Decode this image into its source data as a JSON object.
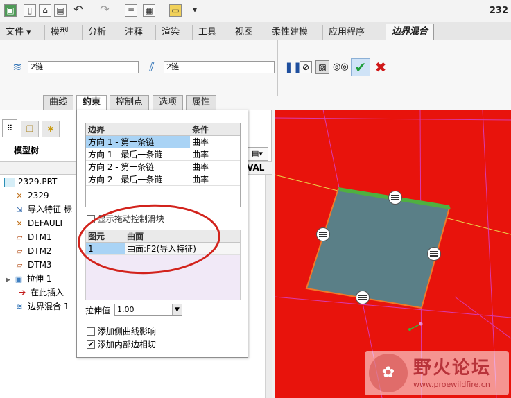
{
  "window": {
    "title_number": "232"
  },
  "ribbon": {
    "tabs": [
      "文件 ▾",
      "模型",
      "分析",
      "注释",
      "渲染",
      "工具",
      "视图",
      "柔性建模",
      "应用程序",
      "边界混合"
    ],
    "active_tab": "边界混合"
  },
  "dashboard": {
    "first_direction_chain": "2链",
    "second_direction_chain": "2链",
    "subtabs": [
      "曲线",
      "约束",
      "控制点",
      "选项",
      "属性"
    ],
    "active_subtab": "约束"
  },
  "model_tree": {
    "header": "模型树",
    "partial_column": "VAL",
    "items": [
      {
        "label": "2329.PRT",
        "icon": "part-icon"
      },
      {
        "label": "2329",
        "icon": "csys-icon"
      },
      {
        "label": "导入特征 标",
        "icon": "import-feature-icon"
      },
      {
        "label": "DEFAULT",
        "icon": "csys-icon"
      },
      {
        "label": "DTM1",
        "icon": "datum-plane-icon"
      },
      {
        "label": "DTM2",
        "icon": "datum-plane-icon"
      },
      {
        "label": "DTM3",
        "icon": "datum-plane-icon"
      },
      {
        "label": "拉伸 1",
        "icon": "extrude-icon"
      },
      {
        "label": "在此插入",
        "icon": "insert-arrow-icon"
      },
      {
        "label": "边界混合 1",
        "icon": "boundary-blend-icon"
      }
    ]
  },
  "constraints": {
    "boundary_header": "边界",
    "condition_header": "条件",
    "rows": [
      {
        "boundary": "方向 1 - 第一条链",
        "condition": "曲率"
      },
      {
        "boundary": "方向 1 - 最后一条链",
        "condition": "曲率"
      },
      {
        "boundary": "方向 2 - 第一条链",
        "condition": "曲率"
      },
      {
        "boundary": "方向 2 - 最后一条链",
        "condition": "曲率"
      }
    ],
    "show_drag_handles_label": "显示拖动控制滑块",
    "element_header": "图元",
    "surface_header": "曲面",
    "element_rows": [
      {
        "element": "1",
        "surface": "曲面:F2(导入特征)"
      }
    ],
    "stretch_label": "拉伸值",
    "stretch_value": "1.00",
    "add_side_curve_label": "添加侧曲线影响",
    "add_inner_edge_label": "添加内部边相切",
    "add_side_curve_checked": false,
    "add_inner_edge_checked": true
  },
  "watermark": {
    "text": "野火论坛",
    "url": "www.proewildfire.cn"
  },
  "colors": {
    "viewport_bg": "#e8130c",
    "surface": "#5a7f87",
    "annotation": "#d2231c",
    "check": "#1e9e3a",
    "cancel": "#d01818"
  }
}
